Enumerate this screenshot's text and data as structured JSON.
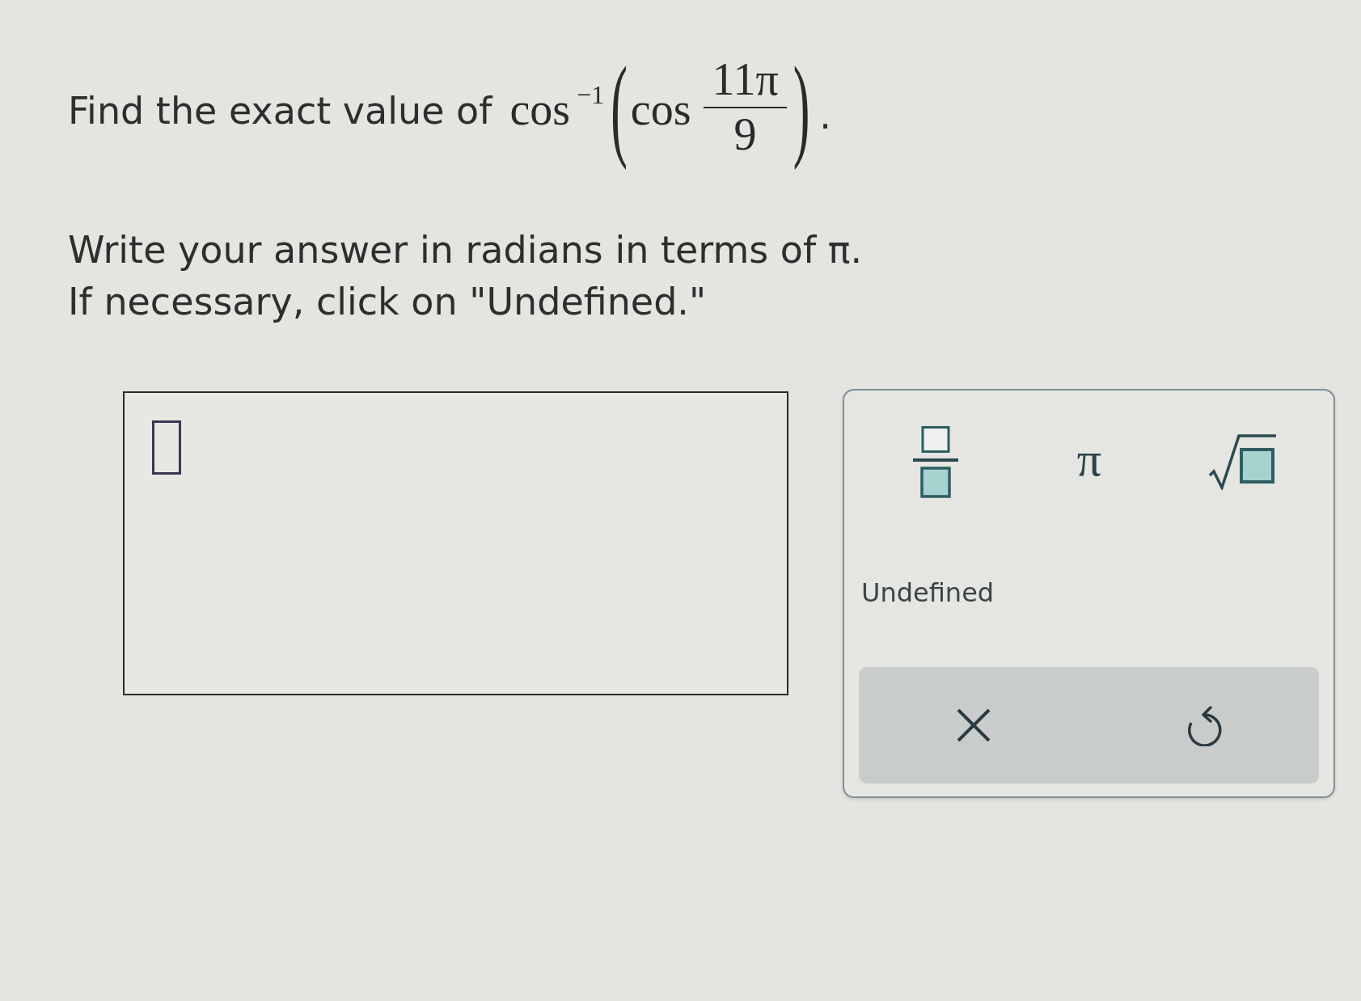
{
  "question": {
    "lead": "Find the exact value of",
    "function": "cos",
    "exponent": "−1",
    "open_paren": "(",
    "inner_function": "cos",
    "numerator": "11π",
    "denominator": "9",
    "close_paren": ")",
    "end_mark": "."
  },
  "instructions": [
    "Write your answer in radians in terms of π.",
    "If necessary, click on \"Undefined.\""
  ],
  "answer_box": {
    "cursor_slot": true
  },
  "keypad": {
    "keys": [
      {
        "kind": "fraction"
      },
      {
        "kind": "pi",
        "label": "π"
      },
      {
        "kind": "sqrt"
      }
    ],
    "undefined_label": "Undefined",
    "actions": [
      {
        "kind": "clear"
      },
      {
        "kind": "undo"
      }
    ]
  }
}
